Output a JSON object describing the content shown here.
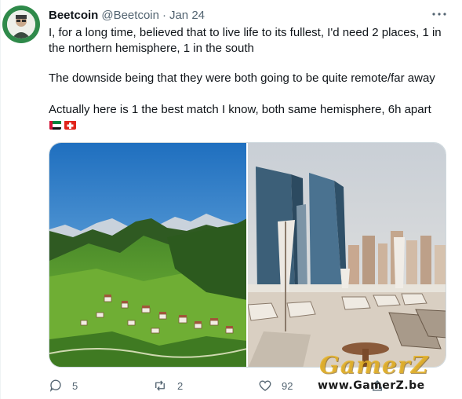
{
  "author": {
    "name": "Beetcoin",
    "handle": "@Beetcoin",
    "separator": "·",
    "date": "Jan 24"
  },
  "tweet": {
    "line1": "I, for a long time, believed that to live life to its fullest, I'd need 2 places, 1 in",
    "line2": "the northern hemisphere, 1 in the south",
    "line3": "The downside being that they were both going to be quite remote/far away",
    "line4": "Actually here is 1 the best match I know, both same hemisphere, 6h apart",
    "flags": [
      "uae-flag",
      "switzerland-flag"
    ]
  },
  "actions": {
    "replies": "5",
    "retweets": "2",
    "likes": "92"
  },
  "watermark": {
    "logo": "GamerZ",
    "url": "www.GamerZ.be"
  },
  "colors": {
    "text": "#0f1419",
    "secondary": "#536471",
    "border": "#cfd9de"
  }
}
